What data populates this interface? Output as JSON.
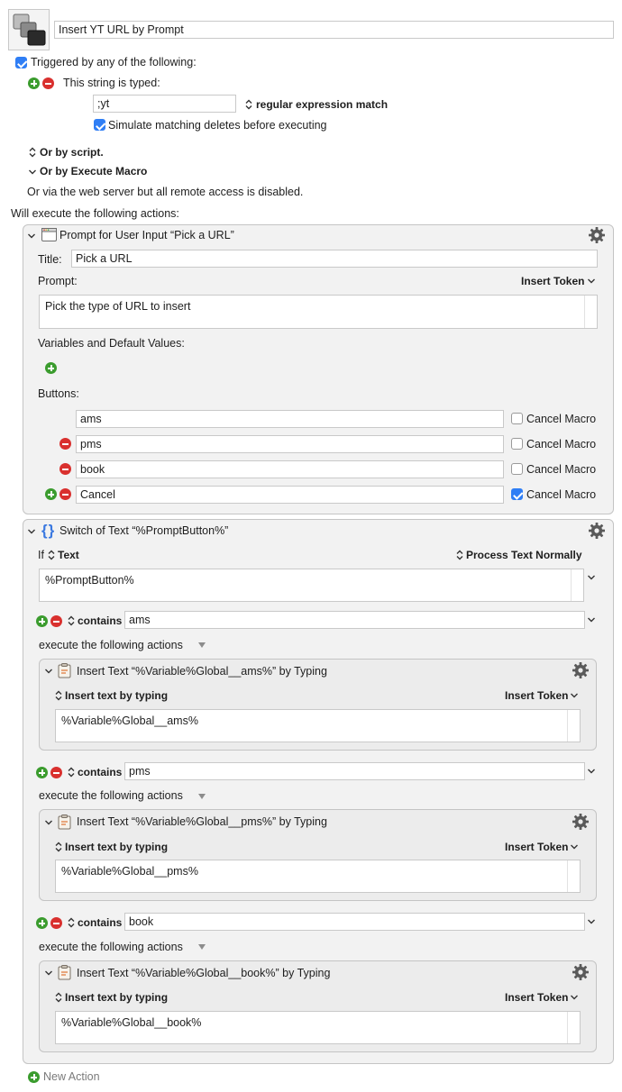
{
  "macro": {
    "name": "Insert YT URL by Prompt"
  },
  "triggers": {
    "header_label": "Triggered by any of the following:",
    "string_typed_label": "This string is typed:",
    "string_value": ";yt",
    "match_mode": "regular expression match",
    "simulate_deletes_label": "Simulate matching deletes before executing",
    "or_by_script": "Or by script.",
    "or_by_execute_macro": "Or by Execute Macro",
    "web_server_note": "Or via the web server but all remote access is disabled."
  },
  "actions_header": "Will execute the following actions:",
  "prompt_action": {
    "title": "Prompt for User Input “Pick a URL”",
    "title_label": "Title:",
    "title_value": "Pick a URL",
    "prompt_label": "Prompt:",
    "insert_token": "Insert Token",
    "prompt_value": "Pick the type of URL to insert",
    "variables_label": "Variables and Default Values:",
    "buttons_label": "Buttons:",
    "cancel_macro_label": "Cancel Macro",
    "buttons": [
      {
        "value": "ams",
        "cancel": false
      },
      {
        "value": "pms",
        "cancel": false
      },
      {
        "value": "book",
        "cancel": false
      },
      {
        "value": "Cancel",
        "cancel": true
      }
    ]
  },
  "switch_action": {
    "title": "Switch of Text “%PromptButton%”",
    "if_label": "If",
    "source": "Text",
    "process_mode": "Process Text Normally",
    "text_value": "%PromptButton%",
    "contains_label": "contains",
    "execute_label": "execute the following actions",
    "cases": [
      {
        "match": "ams",
        "action_title": "Insert Text “%Variable%Global__ams%” by Typing",
        "mode": "Insert text by typing",
        "insert_token": "Insert Token",
        "text": "%Variable%Global__ams%"
      },
      {
        "match": "pms",
        "action_title": "Insert Text “%Variable%Global__pms%” by Typing",
        "mode": "Insert text by typing",
        "insert_token": "Insert Token",
        "text": "%Variable%Global__pms%"
      },
      {
        "match": "book",
        "action_title": "Insert Text “%Variable%Global__book%” by Typing",
        "mode": "Insert text by typing",
        "insert_token": "Insert Token",
        "text": "%Variable%Global__book%"
      }
    ]
  },
  "new_action_label": "New Action",
  "colors": {
    "add": "#3b9c2e",
    "remove": "#d9302e",
    "checkbox": "#2f7ef5",
    "switch_icon": "#3a78e0"
  }
}
